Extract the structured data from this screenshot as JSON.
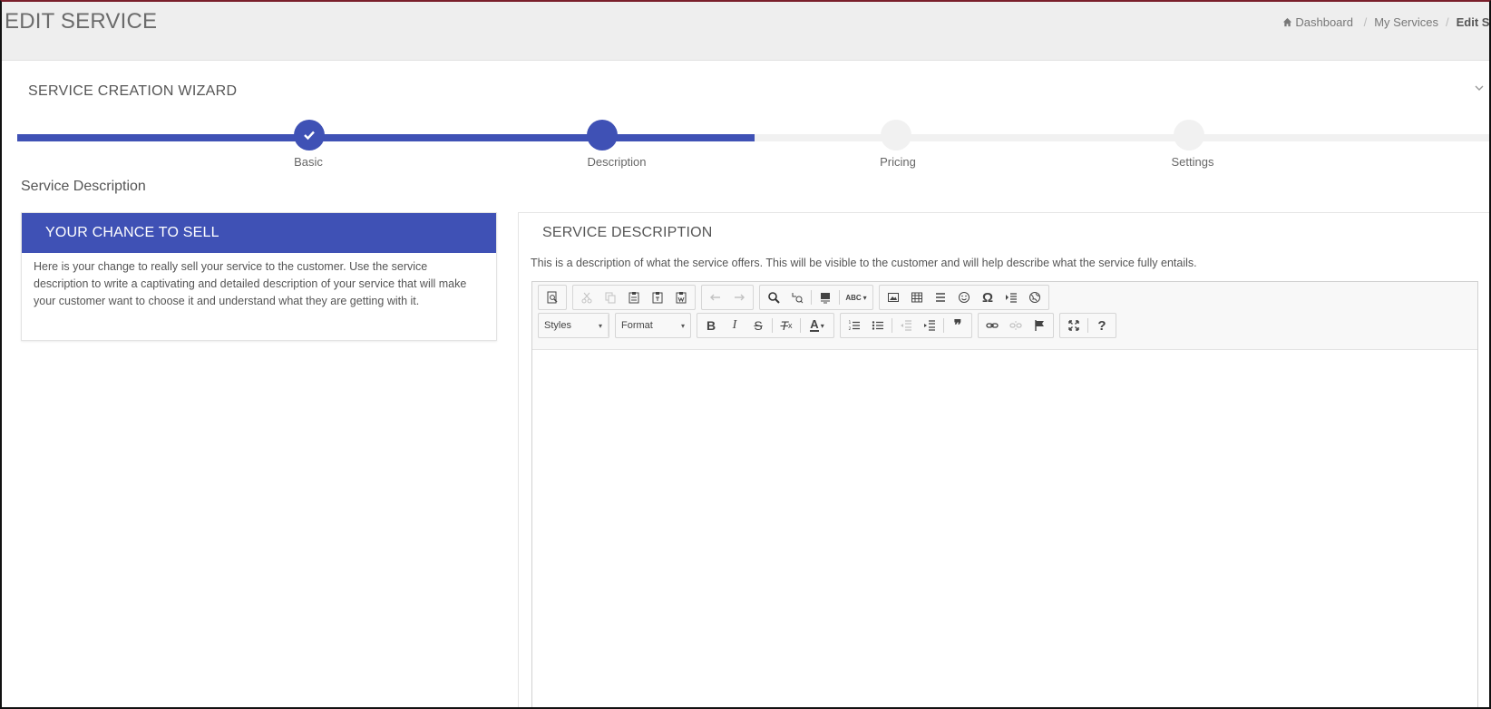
{
  "header": {
    "title": "EDIT SERVICE",
    "breadcrumb": [
      {
        "label": "Dashboard"
      },
      {
        "label": "My Services"
      },
      {
        "label": "Edit Serv"
      }
    ]
  },
  "wizard": {
    "title": "SERVICE CREATION WIZARD",
    "progress_percent": 50,
    "steps": [
      {
        "label": "Basic",
        "state": "done"
      },
      {
        "label": "Description",
        "state": "active"
      },
      {
        "label": "Pricing",
        "state": "pending"
      },
      {
        "label": "Settings",
        "state": "pending"
      }
    ]
  },
  "section": {
    "heading": "Service Description"
  },
  "sell_panel": {
    "title": "YOUR CHANCE TO SELL",
    "body": "Here is your change to really sell your service to the customer. Use the service description to write a captivating and detailed description of your service that will make your customer want to choose it and understand what they are getting with it."
  },
  "description_panel": {
    "title": "SERVICE DESCRIPTION",
    "help": "This is a description of what the service offers. This will be visible to the customer and will help describe what the service fully entails."
  },
  "editor": {
    "styles_label": "Styles",
    "format_label": "Format",
    "strike_glyph": "S",
    "bold_glyph": "B",
    "italic_glyph": "I",
    "clear_glyph": "T",
    "clear_sub_glyph": "x",
    "text_color_glyph": "A",
    "omega_glyph": "Ω",
    "quote_glyph": "❞",
    "help_glyph": "?",
    "spell_glyph": "ABC"
  },
  "colors": {
    "accent": "#3f51b5",
    "track": "#f1f1f1",
    "header_bg": "#eeeeee"
  }
}
